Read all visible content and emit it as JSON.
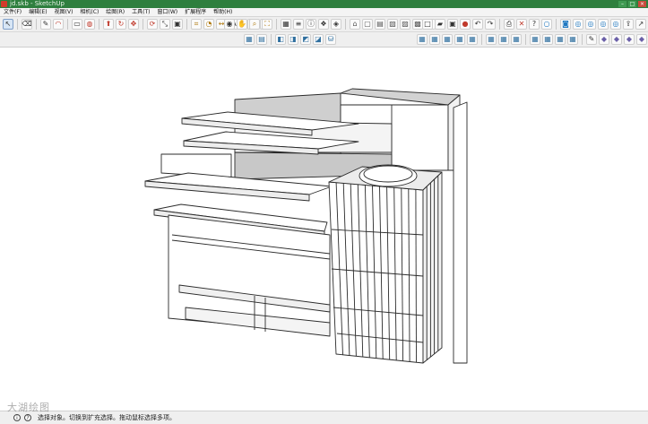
{
  "window": {
    "title": "jd.skb - SketchUp"
  },
  "menu": [
    "文件(F)",
    "编辑(E)",
    "视图(V)",
    "相机(C)",
    "绘图(R)",
    "工具(T)",
    "窗口(W)",
    "扩展程序",
    "帮助(H)"
  ],
  "toolbar1": {
    "left": [
      "select-cursor-icon",
      "eraser-icon",
      "pencil-line-icon",
      "arc-icon",
      "shapes-icon",
      "paint-bucket-icon",
      "push-pull-icon",
      "follow-me-icon",
      "move-icon",
      "rotate-icon",
      "scale-icon",
      "offset-icon",
      "tape-measure-icon",
      "protractor-icon",
      "dimension-icon",
      "text-icon",
      "axes-icon",
      "section-plane-icon"
    ],
    "middle": [
      "orbit-icon",
      "pan-icon",
      "zoom-icon",
      "zoom-extents-icon",
      "styles-icon",
      "layers-icon",
      "entity-info-icon",
      "components-icon",
      "materials-icon",
      "iso-view-icon",
      "top-view-icon",
      "front-view-icon",
      "right-view-icon",
      "back-view-icon",
      "left-view-icon",
      "bottom-view-icon"
    ],
    "right": [
      "new-file-icon",
      "open-folder-icon",
      "save-icon",
      "stop-icon",
      "undo-icon",
      "redo-icon",
      "print-icon",
      "delete-icon",
      "help-icon",
      "circle-icon",
      "camera-icon",
      "globe-icon",
      "warehouse-icon",
      "extension-icon",
      "location-icon",
      "upload-icon",
      "share-icon",
      "send-icon"
    ]
  },
  "toolbar2": {
    "left": [
      "group-icon",
      "outliner-icon",
      "solid-union-icon",
      "solid-subtract-icon",
      "solid-trim-icon",
      "solid-split-icon",
      "database-icon"
    ],
    "right": [
      "soften-icon",
      "shadow-icon",
      "fog-icon",
      "match-photo-icon",
      "edge-style-icon",
      "xray-icon",
      "wireframe-icon",
      "hidden-line-icon",
      "shaded-icon",
      "textured-icon",
      "monochrome-icon",
      "back-edges-icon",
      "paint-brush-icon",
      "section-fill-icon",
      "section-cut-icon",
      "display-section-icon",
      "face-style-icon",
      "component-options-icon",
      "scenes-icon"
    ]
  },
  "status": {
    "message": "选择对象。切换到扩充选择。拖动鼠标选择多项。",
    "watermark": "大湖绘图"
  }
}
